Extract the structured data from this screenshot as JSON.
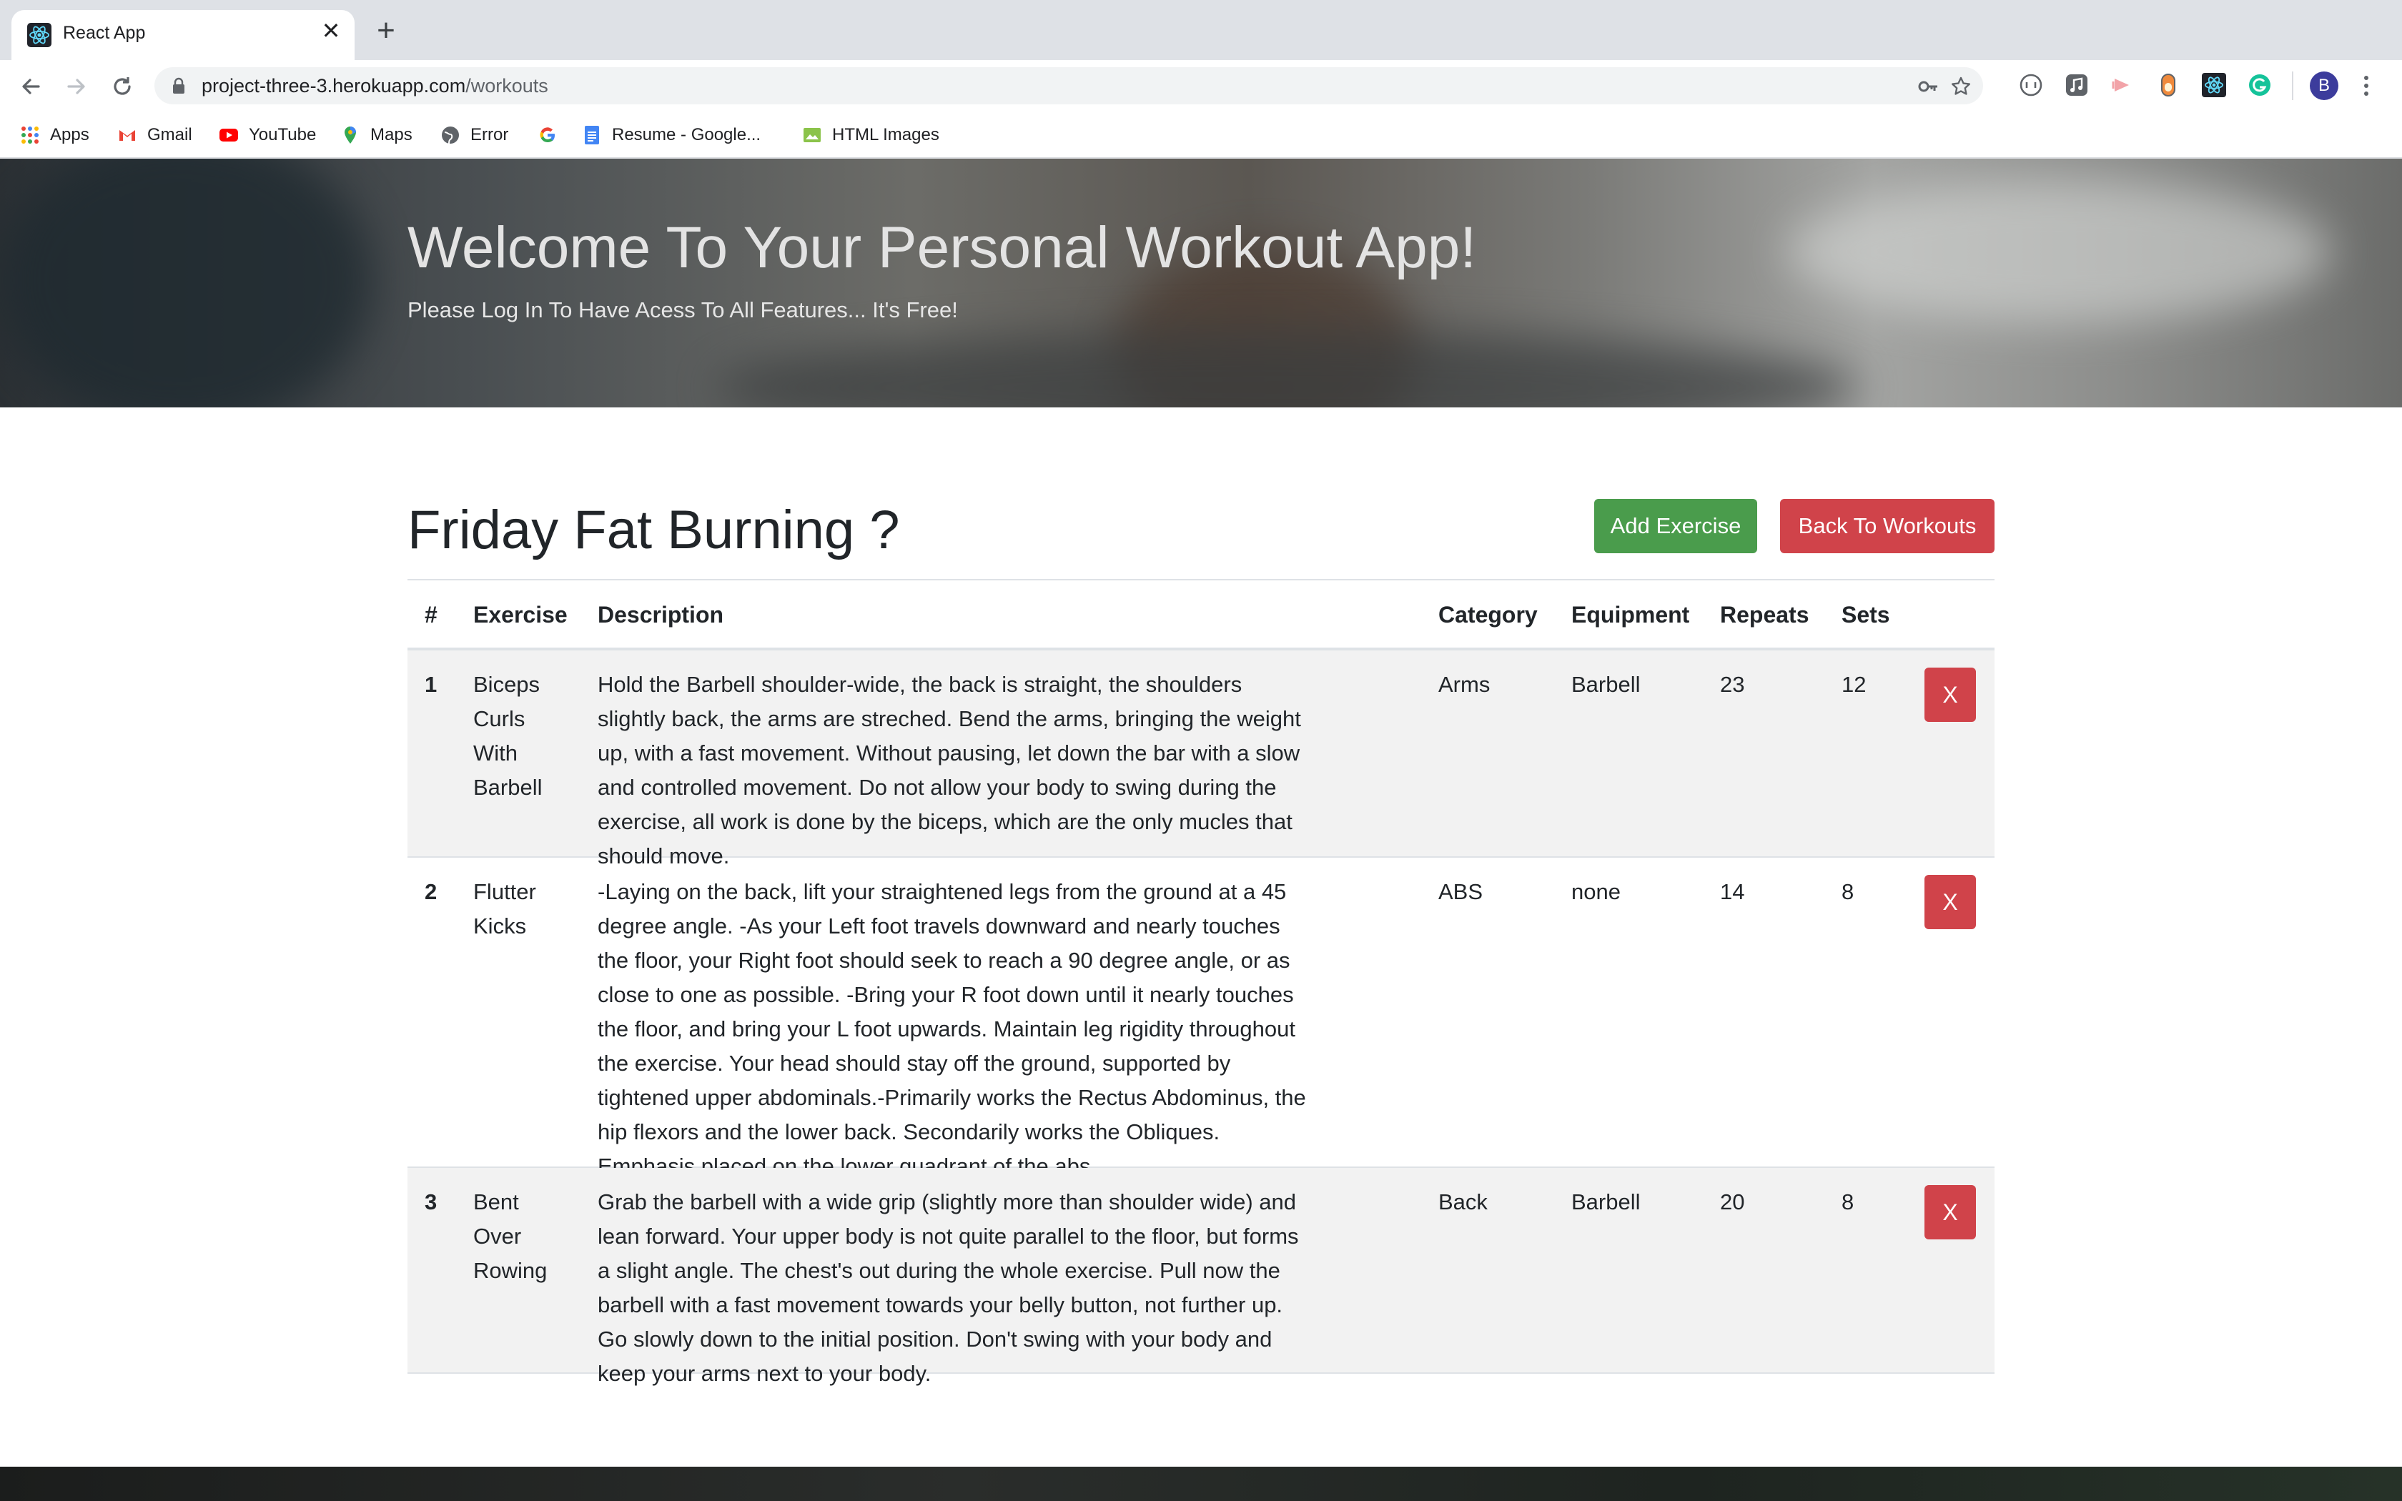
{
  "browser": {
    "tab_title": "React App",
    "tab_close": "✕",
    "new_tab": "+",
    "url_host": "project-three-3.herokuapp.com",
    "url_path": "/workouts",
    "avatar_letter": "B",
    "bookmarks": [
      {
        "label": "Apps",
        "icon": "apps-grid-icon"
      },
      {
        "label": "Gmail",
        "icon": "gmail-icon"
      },
      {
        "label": "YouTube",
        "icon": "youtube-icon"
      },
      {
        "label": "Maps",
        "icon": "maps-icon"
      },
      {
        "label": "Error",
        "icon": "globe-icon"
      },
      {
        "label": "",
        "icon": "google-icon"
      },
      {
        "label": "Resume - Google...",
        "icon": "docs-icon"
      },
      {
        "label": "HTML Images",
        "icon": "image-icon"
      }
    ]
  },
  "hero": {
    "title": "Welcome To Your Personal Workout App!",
    "subtitle": "Please Log In To Have Acess To All Features... It's Free!"
  },
  "workout": {
    "title": "Friday Fat Burning ?",
    "add_exercise_label": "Add Exercise",
    "back_label": "Back To Workouts"
  },
  "table": {
    "headers": [
      "#",
      "Exercise",
      "Description",
      "Category",
      "Equipment",
      "Repeats",
      "Sets"
    ],
    "delete_label": "X",
    "rows": [
      {
        "num": "1",
        "exercise": "Biceps Curls With Barbell",
        "description": "Hold the Barbell shoulder-wide, the back is straight, the shoulders slightly back, the arms are streched. Bend the arms, bringing the weight up, with a fast movement. Without pausing, let down the bar with a slow and controlled movement. Do not allow your body to swing during the exercise, all work is done by the biceps, which are the only mucles that should move.",
        "category": "Arms",
        "equipment": "Barbell",
        "repeats": "23",
        "sets": "12"
      },
      {
        "num": "2",
        "exercise": "Flutter Kicks",
        "description": "-Laying on the back, lift your straightened legs from the ground at a 45 degree angle. -As your Left foot travels downward and nearly touches the floor, your Right foot should seek to reach a 90 degree angle, or as close to one as possible. -Bring your R foot down until it nearly touches the floor, and bring your L foot upwards. Maintain leg rigidity throughout the exercise. Your head should stay off the ground, supported by tightened upper abdominals.-Primarily works the Rectus Abdominus, the hip flexors and the lower back. Secondarily works the Obliques. Emphasis placed on the lower quadrant of the abs.",
        "category": "ABS",
        "equipment": "none",
        "repeats": "14",
        "sets": "8"
      },
      {
        "num": "3",
        "exercise": "Bent Over Rowing",
        "description": "Grab the barbell with a wide grip (slightly more than shoulder wide) and lean forward. Your upper body is not quite parallel to the floor, but forms a slight angle. The chest's out during the whole exercise. Pull now the barbell with a fast movement towards your belly button, not further up. Go slowly down to the initial position. Don't swing with your body and keep your arms next to your body.",
        "category": "Back",
        "equipment": "Barbell",
        "repeats": "20",
        "sets": "8"
      }
    ]
  }
}
